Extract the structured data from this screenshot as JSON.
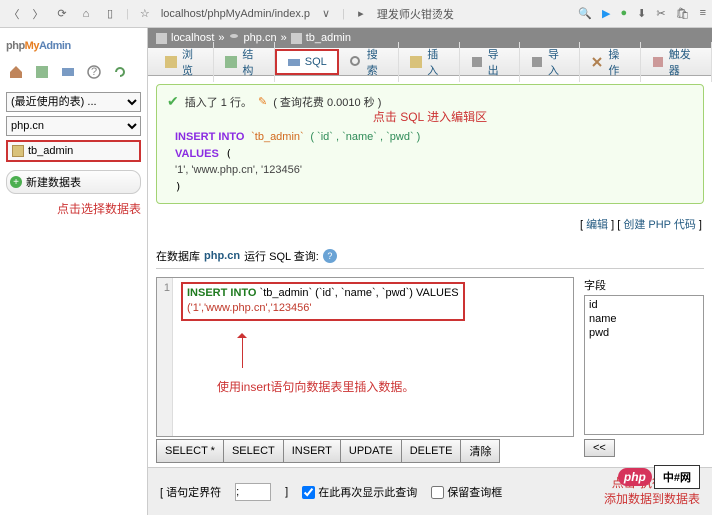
{
  "browser": {
    "url": "localhost/phpMyAdmin/index.p",
    "tab2": "理发师火钳烫发"
  },
  "logo": {
    "p1": "php",
    "p2": "My",
    "p3": "Admin"
  },
  "sidebar": {
    "recent_label": "(最近使用的表) ...",
    "db_label": "php.cn",
    "table": "tb_admin",
    "new_table": "新建数据表",
    "annotation": "点击选择数据表"
  },
  "breadcrumb": {
    "host": "localhost",
    "db": "php.cn",
    "table": "tb_admin"
  },
  "tabs": [
    "浏览",
    "结构",
    "SQL",
    "搜索",
    "插入",
    "导出",
    "导入",
    "操作",
    "触发器"
  ],
  "active_tab": 2,
  "annotation_sql_tab": "点击 SQL 进入编辑区",
  "message": {
    "head_pre": "插入了 1 行。",
    "head_time": "( 查询花费 0.0010 秒 )",
    "sql_kw1": "INSERT INTO",
    "sql_tbl": "`tb_admin`",
    "sql_cols": "( `id` , `name` , `pwd` )",
    "sql_kw2": "VALUES",
    "sql_vals": "'1', 'www.php.cn', '123456'"
  },
  "links": {
    "edit": "编辑",
    "create_php": "创建 PHP 代码"
  },
  "query": {
    "label_pre": "在数据库",
    "db": "php.cn",
    "label_post": "运行 SQL 查询:",
    "code_line1_kw": "INSERT INTO",
    "code_line1_rest": "`tb_admin` (`id`, `name`, `pwd`) VALUES",
    "code_line2": "('1','www.php.cn','123456'",
    "annotation": "使用insert语句向数据表里插入数据。"
  },
  "editor_buttons": [
    "SELECT *",
    "SELECT",
    "INSERT",
    "UPDATE",
    "DELETE",
    "清除"
  ],
  "fields": {
    "label": "字段",
    "items": [
      "id",
      "name",
      "pwd"
    ],
    "btn": "<<"
  },
  "bottom": {
    "delimiter_label": "语句定界符",
    "delimiter_value": ";",
    "show_again": "在此再次显示此查询",
    "keep_box": "保留查询框",
    "annotation": "点击\"执行\"按钮\n添加数据到数据表",
    "php_badge": "php",
    "exec": "中#网"
  }
}
